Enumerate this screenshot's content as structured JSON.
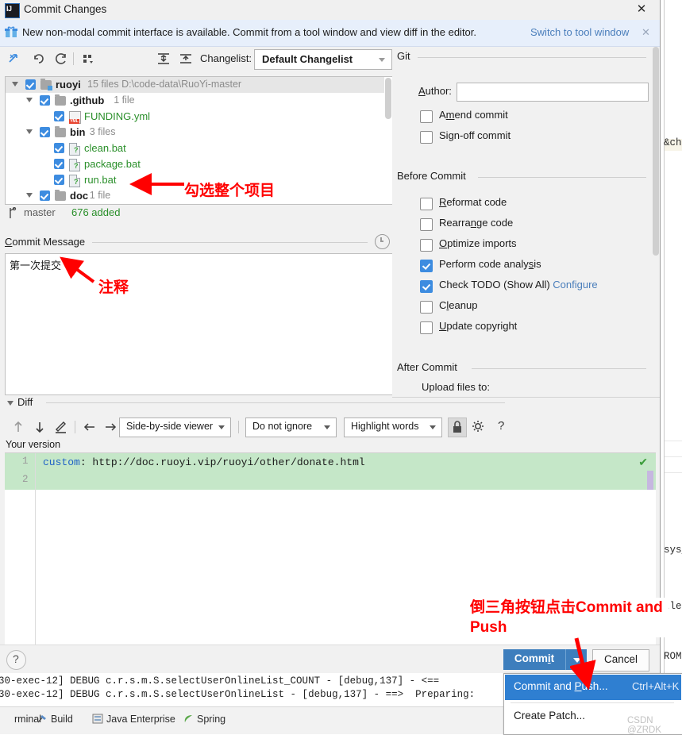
{
  "window": {
    "title": "Commit Changes",
    "app_icon": "intellij-idea-icon",
    "close_label": "✕"
  },
  "notice": {
    "icon": "gift-icon",
    "text": "New non-modal commit interface is available. Commit from a tool window and view diff in the editor.",
    "link": "Switch to tool window",
    "close": "✕"
  },
  "toolbar": {
    "icons": [
      "show-diff-icon",
      "revert-icon",
      "refresh-icon",
      "group-by-icon",
      "expand-all-icon",
      "collapse-all-icon"
    ],
    "changelist_label": "Changelist:",
    "changelist_value": "Default Changelist"
  },
  "tree": {
    "rows": [
      {
        "indent": 0,
        "twisty": true,
        "checked": true,
        "icon": "folder-module-icon",
        "name": "ruoyi",
        "bold": true,
        "green": false,
        "meta": "15 files  D:\\code-data\\RuoYi-master",
        "selected": true
      },
      {
        "indent": 1,
        "twisty": true,
        "checked": true,
        "icon": "folder-icon",
        "name": ".github",
        "bold": true,
        "green": false,
        "meta": "1 file",
        "selected": false
      },
      {
        "indent": 2,
        "twisty": false,
        "checked": true,
        "icon": "yml-file-icon",
        "name": "FUNDING.yml",
        "bold": false,
        "green": true,
        "meta": "",
        "selected": false
      },
      {
        "indent": 1,
        "twisty": true,
        "checked": true,
        "icon": "folder-icon",
        "name": "bin",
        "bold": true,
        "green": false,
        "meta": "3 files",
        "selected": false
      },
      {
        "indent": 2,
        "twisty": false,
        "checked": true,
        "icon": "bat-file-icon",
        "name": "clean.bat",
        "bold": false,
        "green": true,
        "meta": "",
        "selected": false
      },
      {
        "indent": 2,
        "twisty": false,
        "checked": true,
        "icon": "bat-file-icon",
        "name": "package.bat",
        "bold": false,
        "green": true,
        "meta": "",
        "selected": false
      },
      {
        "indent": 2,
        "twisty": false,
        "checked": true,
        "icon": "bat-file-icon",
        "name": "run.bat",
        "bold": false,
        "green": true,
        "meta": "",
        "selected": false
      },
      {
        "indent": 1,
        "twisty": true,
        "checked": true,
        "icon": "folder-icon",
        "name": "doc",
        "bold": true,
        "green": false,
        "meta": "1 file",
        "selected": false
      }
    ]
  },
  "branch": {
    "icon": "branch-icon",
    "name": "master",
    "added": "676 added"
  },
  "commit_message": {
    "title": "Commit Message",
    "history_icon": "clock-icon",
    "value": "第一次提交"
  },
  "git_section": {
    "label": "Git",
    "author_label": "Author:",
    "author_value": "",
    "options": [
      {
        "label": "Amend commit",
        "checked": false
      },
      {
        "label": "Sign-off commit",
        "checked": false
      }
    ]
  },
  "before_commit": {
    "label": "Before Commit",
    "options": [
      {
        "label": "Reformat code",
        "checked": false,
        "link": ""
      },
      {
        "label": "Rearrange code",
        "checked": false,
        "link": ""
      },
      {
        "label": "Optimize imports",
        "checked": false,
        "link": ""
      },
      {
        "label": "Perform code analysis",
        "checked": true,
        "link": ""
      },
      {
        "label": "Check TODO (Show All)",
        "checked": true,
        "link": "Configure"
      },
      {
        "label": "Cleanup",
        "checked": false,
        "link": ""
      },
      {
        "label": "Update copyright",
        "checked": false,
        "link": ""
      }
    ]
  },
  "after_commit": {
    "label": "After Commit",
    "upload_label": "Upload files to:"
  },
  "diff": {
    "title": "Diff",
    "toolbar_icons": [
      "prev-diff-icon",
      "next-diff-icon",
      "edit-icon",
      "arrow-left-icon",
      "arrow-right-icon"
    ],
    "viewer_mode": "Side-by-side viewer",
    "ignore_mode": "Do not ignore",
    "highlight_mode": "Highlight words",
    "lock_icon": "lock-icon",
    "settings_icon": "gear-icon",
    "help_icon": "question-icon",
    "version_label": "Your version",
    "lines": [
      {
        "num": "1",
        "key": "custom",
        "rest": ": http://doc.ruoyi.vip/ruoyi/other/donate.html"
      },
      {
        "num": "2",
        "key": "",
        "rest": ""
      }
    ],
    "status_icon": "check-icon"
  },
  "buttons": {
    "help": "?",
    "commit": "Commit",
    "commit_dropdown_icon": "chevron-down-icon",
    "cancel": "Cancel"
  },
  "popup_menu": {
    "items": [
      {
        "label": "Commit and Push...",
        "shortcut": "Ctrl+Alt+K",
        "highlighted": true
      },
      {
        "label": "Create Patch...",
        "shortcut": "",
        "highlighted": false
      }
    ],
    "watermark": "CSDN @ZRDK"
  },
  "annotations": [
    {
      "text": "勾选整个项目",
      "color": "#ff0000"
    },
    {
      "text": "注释",
      "color": "#ff0000"
    },
    {
      "text": "倒三角按钮点击Commit and Push",
      "color": "#ff0000"
    }
  ],
  "console": {
    "line1": "30-exec-12] DEBUG c.r.s.m.S.selectUserOnlineList_COUNT - [debug,137] - <==",
    "line2": "30-exec-12] DEBUG c.r.s.m.S.selectUserOnlineList - [debug,137] - ==>  Preparing:"
  },
  "statusbar": {
    "items": [
      {
        "label": "rminal",
        "icon": "terminal-icon"
      },
      {
        "label": "Build",
        "icon": "hammer-icon"
      },
      {
        "label": "Java Enterprise",
        "icon": "java-icon"
      },
      {
        "label": "Spring",
        "icon": "leaf-icon"
      }
    ]
  },
  "background_editor": {
    "fragments": [
      "&ch",
      "sys_",
      "tle,",
      "ROM"
    ]
  }
}
